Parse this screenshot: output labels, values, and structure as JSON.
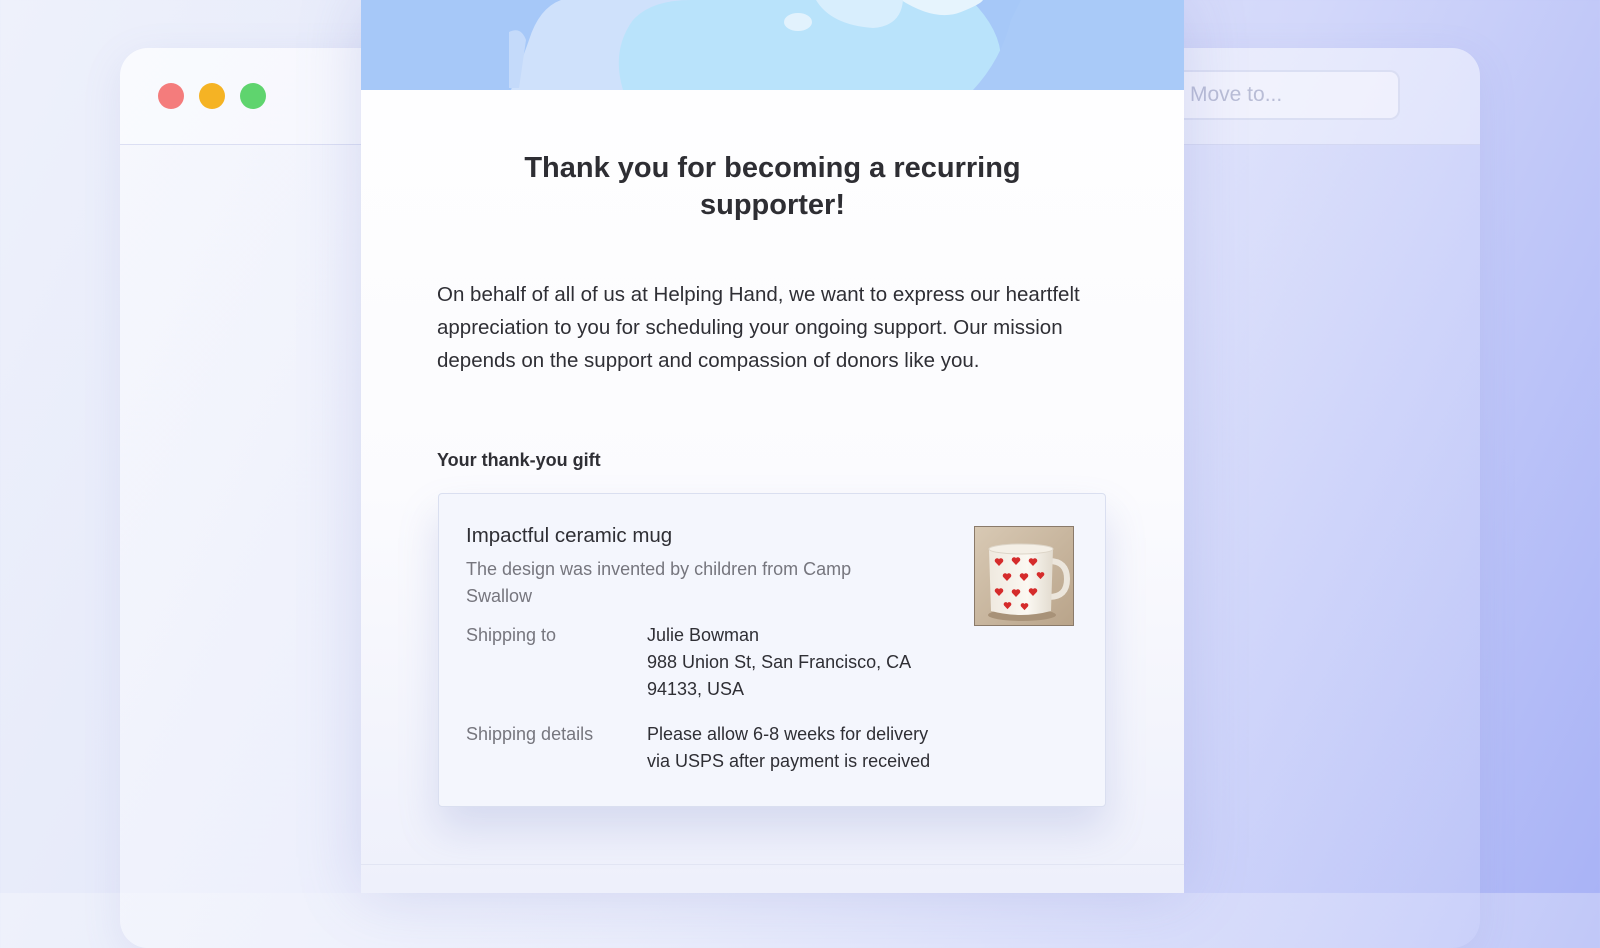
{
  "window": {
    "controls": [
      "close",
      "minimize",
      "maximize"
    ]
  },
  "toolbar": {
    "move_to_placeholder": "Move to..."
  },
  "email": {
    "title": "Thank you for becoming a recurring supporter!",
    "body": "On behalf of all of us at Helping Hand, we want to express our heartfelt appreciation to you for scheduling your ongoing support. Our mission depends on the support and compassion of donors like you.",
    "gift_heading": "Your thank-you gift",
    "gift": {
      "name": "Impactful ceramic mug",
      "description": "The design was invented by children from Camp Swallow",
      "image_icon": "heart-mug-image",
      "shipping_to_label": "Shipping to",
      "recipient_name": "Julie Bowman",
      "address_line1": "988 Union St, San Francisco, CA",
      "address_line2": "94133, USA",
      "shipping_details_label": "Shipping details",
      "shipping_details_line1": "Please allow 6-8 weeks for delivery",
      "shipping_details_line2": "via USPS after payment is received"
    }
  },
  "colors": {
    "close": "#f47c7c",
    "minimize": "#f5b324",
    "maximize": "#5fd46e",
    "hero": "#a6c8f8",
    "text": "#2f2f35",
    "muted_text": "#76767e"
  }
}
